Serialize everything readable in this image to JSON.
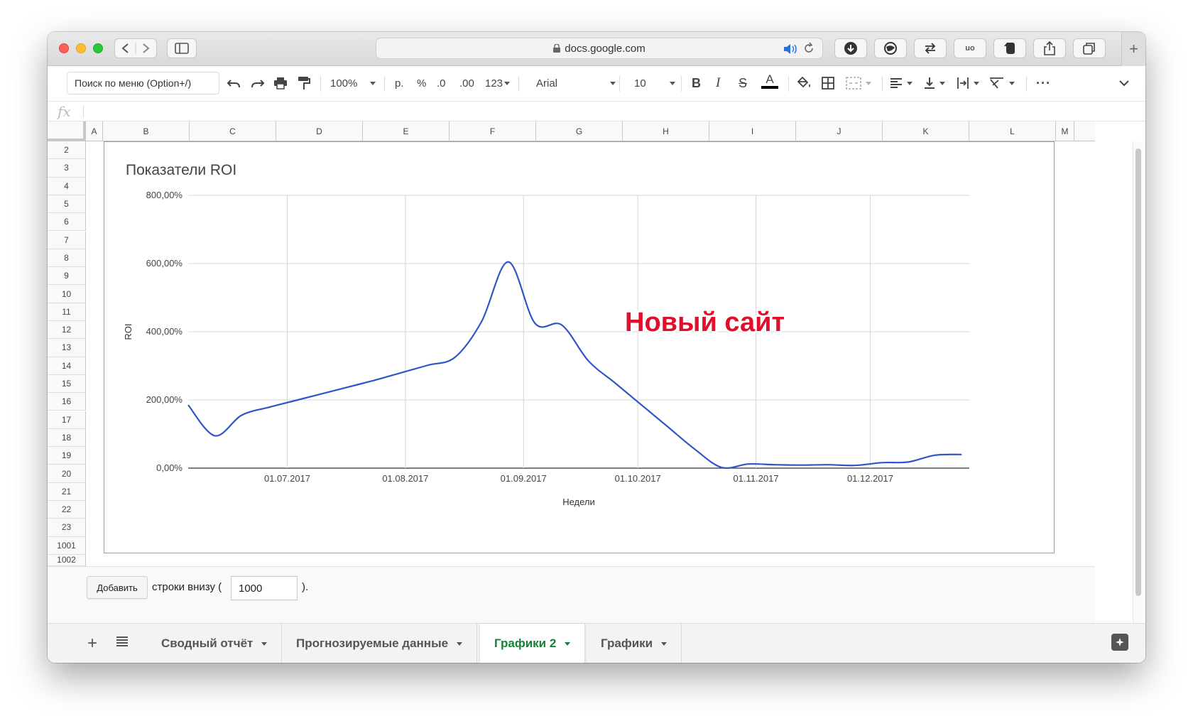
{
  "browser": {
    "url": "docs.google.com"
  },
  "toolbar": {
    "menu_search_placeholder": "Поиск по меню (Option+/)",
    "zoom": "100%",
    "currency": "р.",
    "percent": "%",
    "decrease_decimals": ".0",
    "increase_decimals": ".00",
    "number_format": "123",
    "font": "Arial",
    "font_size": "10",
    "bold": "B",
    "italic": "I",
    "strike": "S",
    "text_color": "A",
    "more": "···"
  },
  "formula_bar": {
    "fx": "fx"
  },
  "columns": [
    "A",
    "B",
    "C",
    "D",
    "E",
    "F",
    "G",
    "H",
    "I",
    "J",
    "K",
    "L",
    "M"
  ],
  "rows": [
    "2",
    "3",
    "4",
    "5",
    "6",
    "7",
    "8",
    "9",
    "10",
    "11",
    "12",
    "13",
    "14",
    "15",
    "16",
    "17",
    "18",
    "19",
    "20",
    "21",
    "22",
    "23",
    "1001",
    "1002"
  ],
  "add_rows": {
    "button": "Добавить",
    "text": "строки внизу (",
    "value": "1000",
    "close": ")."
  },
  "sheet_tabs": [
    {
      "label": "Сводный отчёт",
      "active": false
    },
    {
      "label": "Прогнозируемые данные",
      "active": false
    },
    {
      "label": "Графики 2",
      "active": true
    },
    {
      "label": "Графики",
      "active": false
    }
  ],
  "annotation": "Новый сайт",
  "chart_data": {
    "type": "line",
    "title": "Показатели ROI",
    "xlabel": "Недели",
    "ylabel": "ROI",
    "ylim": [
      0,
      800
    ],
    "y_ticks": [
      "0,00%",
      "200,00%",
      "400,00%",
      "600,00%",
      "800,00%"
    ],
    "y_tick_values": [
      0,
      200,
      400,
      600,
      800
    ],
    "x_ticks": [
      "01.07.2017",
      "01.08.2017",
      "01.09.2017",
      "01.10.2017",
      "01.11.2017",
      "01.12.2017"
    ],
    "x_tick_dates": [
      "2017-07-01",
      "2017-08-01",
      "2017-09-01",
      "2017-10-01",
      "2017-11-01",
      "2017-12-01"
    ],
    "xlim": [
      "2017-06-05",
      "2017-12-27"
    ],
    "grid": true,
    "color": "#2f55c9",
    "series": [
      {
        "x": [
          "2017-06-05",
          "2017-06-12",
          "2017-06-19",
          "2017-06-26",
          "2017-07-03",
          "2017-07-10",
          "2017-07-17",
          "2017-07-24",
          "2017-07-31",
          "2017-08-07",
          "2017-08-14",
          "2017-08-21",
          "2017-08-28",
          "2017-09-04",
          "2017-09-11",
          "2017-09-18",
          "2017-09-25",
          "2017-10-02",
          "2017-10-09",
          "2017-10-16",
          "2017-10-23",
          "2017-10-30",
          "2017-11-06",
          "2017-11-13",
          "2017-11-20",
          "2017-11-27",
          "2017-12-04",
          "2017-12-11",
          "2017-12-18",
          "2017-12-25"
        ],
        "values": [
          185,
          95,
          155,
          178,
          198,
          218,
          238,
          258,
          280,
          302,
          325,
          430,
          605,
          425,
          420,
          315,
          250,
          185,
          120,
          55,
          2,
          12,
          10,
          9,
          10,
          8,
          16,
          18,
          38,
          40
        ]
      }
    ]
  }
}
